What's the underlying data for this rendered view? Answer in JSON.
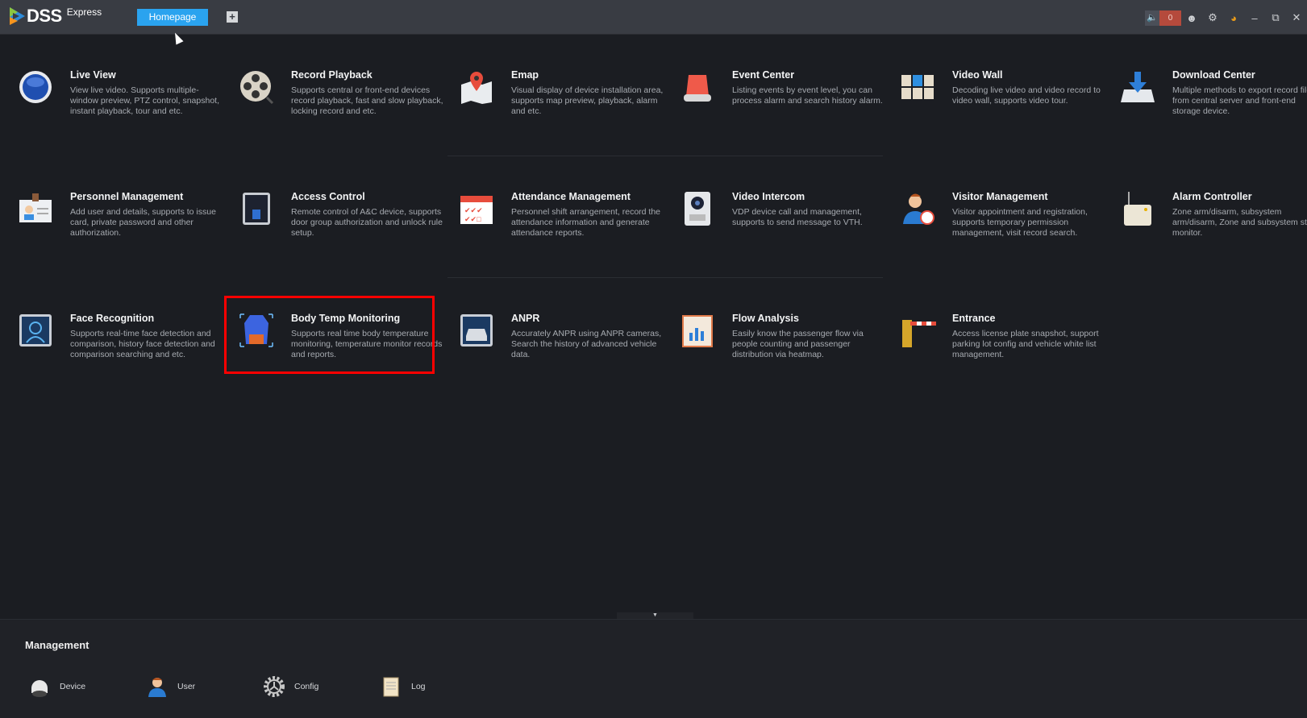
{
  "app": {
    "logo": "DSS",
    "logo_sub": "Express"
  },
  "tabs": [
    {
      "label": "Homepage",
      "active": true
    }
  ],
  "add_tab_label": "+",
  "tray": {
    "alarm_count": "0"
  },
  "modules": [
    {
      "title": "Live View",
      "desc": "View live video. Supports multiple-window preview, PTZ control, snapshot, instant playback, tour and etc.",
      "icon": "live-view-icon"
    },
    {
      "title": "Record Playback",
      "desc": "Supports central or front-end devices record playback, fast and slow playback, locking record and etc.",
      "icon": "film-reel-icon"
    },
    {
      "title": "Emap",
      "desc": "Visual display of device installation area, supports map preview, playback, alarm and etc.",
      "icon": "map-pin-icon"
    },
    {
      "title": "Event Center",
      "desc": "Listing events by event level, you can process alarm and search history alarm.",
      "icon": "alarm-light-icon"
    },
    {
      "title": "Video Wall",
      "desc": "Decoding live video and video record to video wall, supports video tour.",
      "icon": "video-wall-icon"
    },
    {
      "title": "Download Center",
      "desc": "Multiple methods to export record file from central server and front-end storage device.",
      "icon": "download-icon"
    },
    {
      "title": "Personnel Management",
      "desc": "Add user and details, supports to issue card, private password and other authorization.",
      "icon": "id-card-icon"
    },
    {
      "title": "Access Control",
      "desc": "Remote control of A&C device, supports door group authorization and unlock rule setup.",
      "icon": "access-panel-icon"
    },
    {
      "title": "Attendance Management",
      "desc": "Personnel shift arrangement, record the attendance information and generate attendance reports.",
      "icon": "calendar-icon"
    },
    {
      "title": "Video Intercom",
      "desc": "VDP device call and management, supports to send message to VTH.",
      "icon": "intercom-icon"
    },
    {
      "title": "Visitor Management",
      "desc": "Visitor appointment and registration, supports temporary permission management, visit record search.",
      "icon": "visitor-icon"
    },
    {
      "title": "Alarm Controller",
      "desc": "Zone arm/disarm, subsystem arm/disarm, Zone and subsystem status monitor.",
      "icon": "alarm-controller-icon"
    },
    {
      "title": "Face Recognition",
      "desc": "Supports real-time face detection and comparison, history face detection and comparison searching and etc.",
      "icon": "face-scan-icon"
    },
    {
      "title": "Body Temp Monitoring",
      "desc": "Supports real time body temperature monitoring, temperature monitor records and reports.",
      "icon": "body-temp-icon"
    },
    {
      "title": "ANPR",
      "desc": "Accurately ANPR using ANPR cameras, Search the history of advanced vehicle data.",
      "icon": "car-plate-icon"
    },
    {
      "title": "Flow Analysis",
      "desc": "Easily know the passenger flow via people counting and passenger distribution via heatmap.",
      "icon": "chart-clipboard-icon"
    },
    {
      "title": "Entrance",
      "desc": "Access license plate snapshot, support parking lot config and vehicle white list management.",
      "icon": "barrier-gate-icon"
    }
  ],
  "management": {
    "title": "Management",
    "items": [
      {
        "label": "Device",
        "icon": "camera-dome-icon"
      },
      {
        "label": "User",
        "icon": "user-icon"
      },
      {
        "label": "Config",
        "icon": "gear-icon"
      },
      {
        "label": "Log",
        "icon": "notepad-icon"
      }
    ]
  },
  "colors": {
    "accent": "#2aa3ef",
    "highlight": "#ff0000",
    "alarm": "#b54a3c"
  }
}
